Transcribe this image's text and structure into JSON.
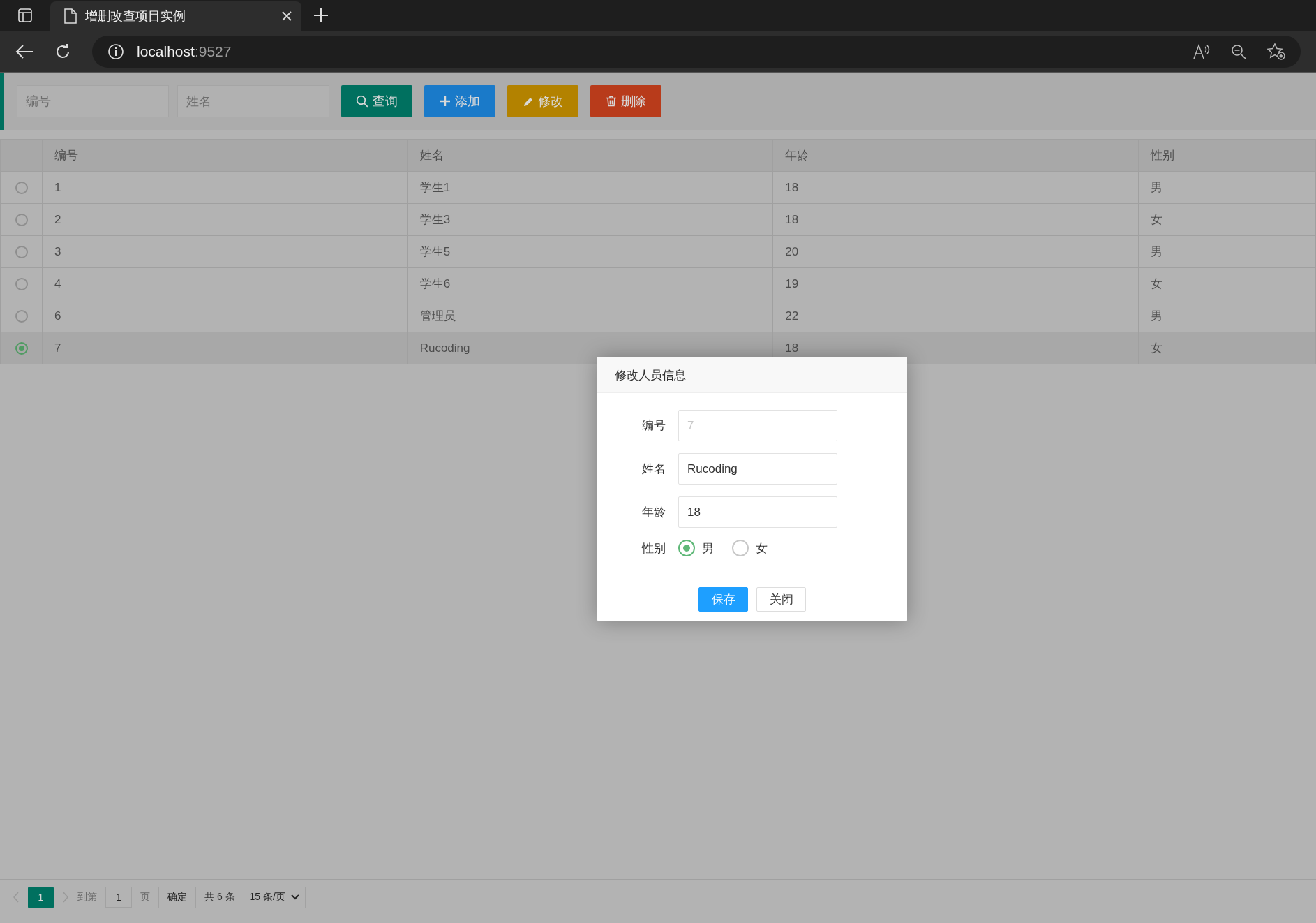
{
  "browser": {
    "tab": {
      "title": "增删改查项目实例"
    },
    "url": {
      "host": "localhost",
      "port": ":9527"
    }
  },
  "toolbar": {
    "fields": [
      {
        "placeholder": "编号"
      },
      {
        "placeholder": "姓名"
      }
    ],
    "buttons": [
      {
        "kind": "search",
        "label": "查询"
      },
      {
        "kind": "add",
        "label": "添加"
      },
      {
        "kind": "edit",
        "label": "修改"
      },
      {
        "kind": "delete",
        "label": "删除"
      }
    ]
  },
  "table": {
    "columns": [
      "编号",
      "姓名",
      "年龄",
      "性别"
    ],
    "rows": [
      {
        "selected": false,
        "cells": [
          "1",
          "学生1",
          "18",
          "男"
        ]
      },
      {
        "selected": false,
        "cells": [
          "2",
          "学生3",
          "18",
          "女"
        ]
      },
      {
        "selected": false,
        "cells": [
          "3",
          "学生5",
          "20",
          "男"
        ]
      },
      {
        "selected": false,
        "cells": [
          "4",
          "学生6",
          "19",
          "女"
        ]
      },
      {
        "selected": false,
        "cells": [
          "6",
          "管理员",
          "22",
          "男"
        ]
      },
      {
        "selected": true,
        "cells": [
          "7",
          "Rucoding",
          "18",
          "女"
        ]
      }
    ]
  },
  "pagination": {
    "pages": [
      {
        "label": "1",
        "selected": true
      }
    ],
    "goto_label": "到第",
    "goto_value": "1",
    "page_unit": "页",
    "confirm": "确定",
    "total": "共 6 条",
    "page_size": "15 条/页"
  },
  "dialog": {
    "title": "修改人员信息",
    "fields": [
      {
        "label": "编号",
        "value": "7",
        "disabled": true
      },
      {
        "label": "姓名",
        "value": "Rucoding",
        "disabled": false
      },
      {
        "label": "年龄",
        "value": "18",
        "disabled": false
      }
    ],
    "gender": {
      "label": "性别",
      "options": [
        {
          "label": "男",
          "selected": true
        },
        {
          "label": "女",
          "selected": false
        }
      ]
    },
    "buttons": [
      {
        "kind": "primary",
        "label": "保存"
      },
      {
        "kind": "default",
        "label": "关闭"
      }
    ]
  }
}
